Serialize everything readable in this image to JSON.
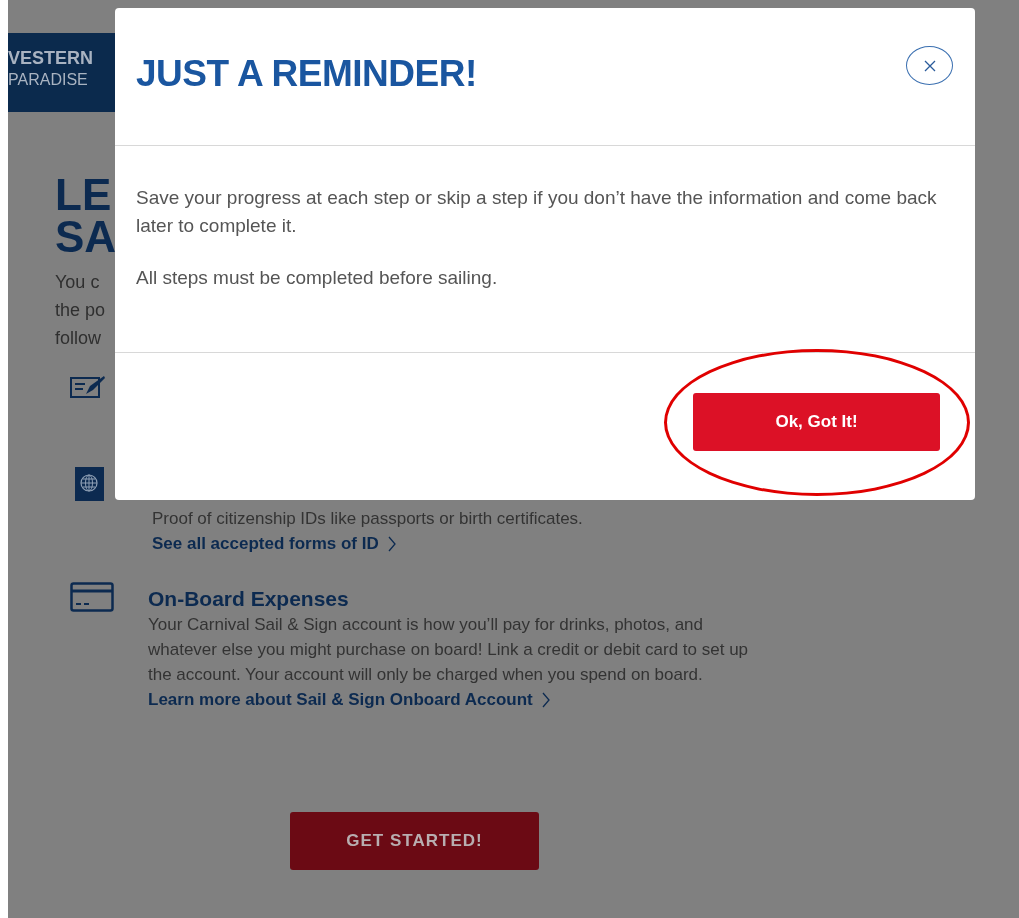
{
  "page": {
    "brand": [
      "VESTERN",
      "PARADISE"
    ],
    "headline": [
      "LE",
      "SA"
    ],
    "intro": [
      "You c",
      "the po",
      "follow"
    ],
    "sections": [
      {
        "kind": "icon"
      },
      {
        "kind": "linked",
        "description": "Proof of citizenship IDs like passports or birth certificates.",
        "link": "See all accepted forms of ID"
      },
      {
        "kind": "titled",
        "title": "On-Board Expenses",
        "description": "Your Carnival Sail & Sign account is how you’ll pay for drinks, photos, and whatever else you might purchase on board! Link a credit or debit card to set up the account. Your account will only be charged when you spend on board.",
        "link": "Learn more about Sail & Sign Onboard Account"
      }
    ],
    "button": "GET STARTED!"
  },
  "modal": {
    "title": "JUST A REMINDER!",
    "paragraphs": [
      "Save your progress at each step or skip a step if you don’t have the information and come back later to complete it.",
      "All steps must be completed before sailing."
    ],
    "button": "Ok, Got It!"
  }
}
